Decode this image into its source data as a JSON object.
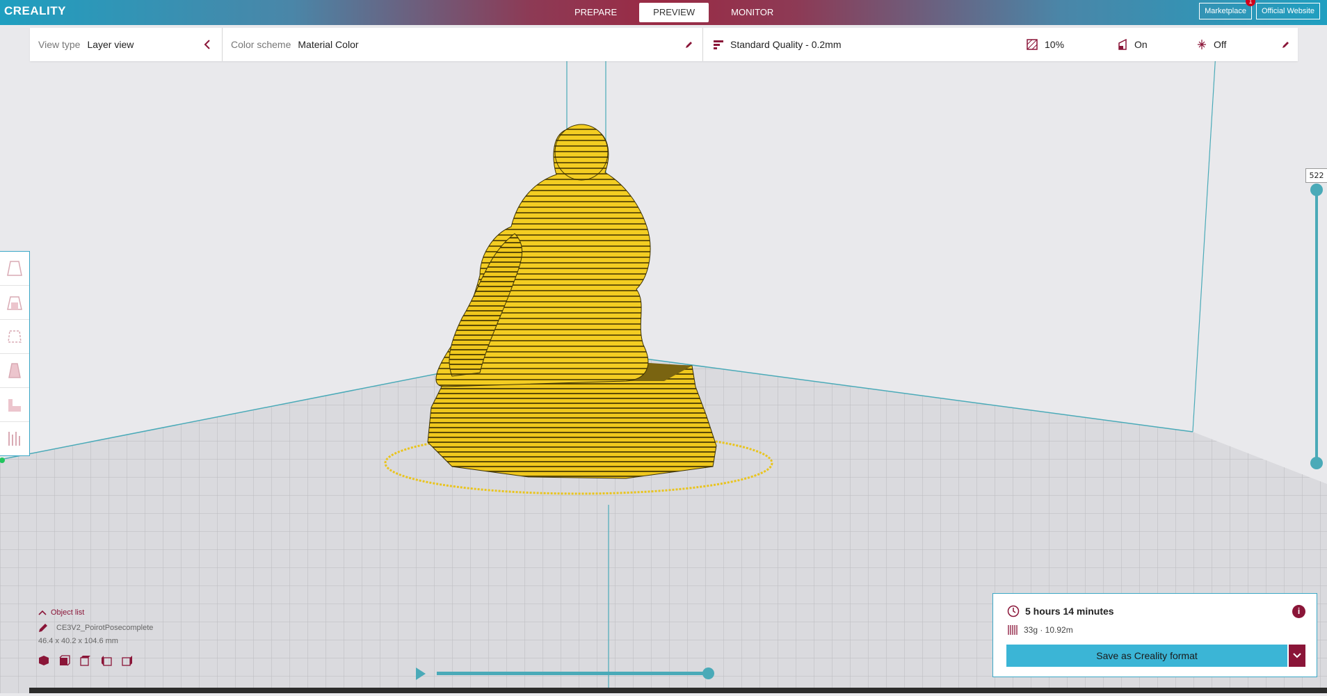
{
  "app": {
    "logo": "CREALITY"
  },
  "stages": [
    {
      "label": "PREPARE",
      "active": false
    },
    {
      "label": "PREVIEW",
      "active": true
    },
    {
      "label": "MONITOR",
      "active": false
    }
  ],
  "top_links": {
    "marketplace": "Marketplace",
    "marketplace_badge": "1",
    "website": "Official Website"
  },
  "header": {
    "view_type_label": "View type",
    "view_type_value": "Layer view",
    "color_scheme_label": "Color scheme",
    "color_scheme_value": "Material Color",
    "quality": "Standard Quality - 0.2mm",
    "infill": "10%",
    "support": "On",
    "adhesion": "Off"
  },
  "layer_slider": {
    "value": "522",
    "upper": 1.0,
    "lower": 0.0
  },
  "object_list": {
    "title": "Object list",
    "object_name": "CE3V2_PoirotPosecomplete",
    "dimensions": "46.4 x 40.2 x 104.6 mm"
  },
  "print_info": {
    "time": "5 hours 14 minutes",
    "material": "33g · 10.92m",
    "save_label": "Save as Creality format"
  },
  "colors": {
    "accent": "#3bb5d6",
    "brand": "#8a1538",
    "model": "#f2cc1f"
  }
}
